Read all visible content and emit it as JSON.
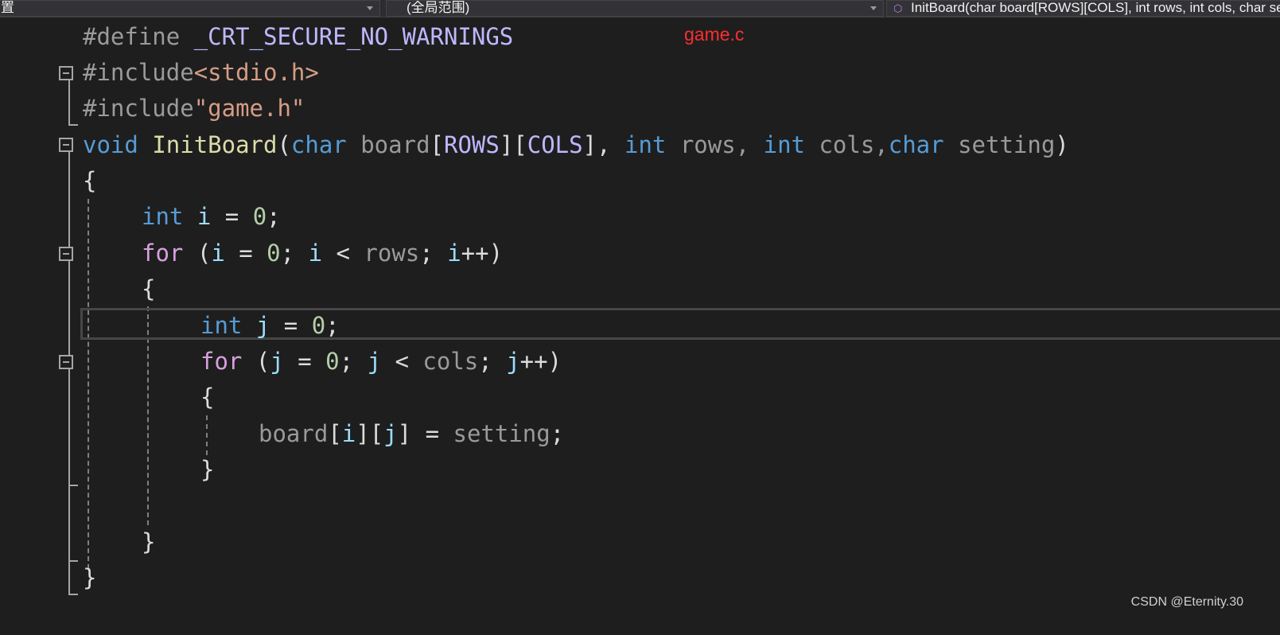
{
  "navbar": {
    "project_combo": "置",
    "scope_combo": "(全局范围)",
    "member_combo": "InitBoard(char board[ROWS][COLS], int rows, int cols, char setting)"
  },
  "annotation": "game.c",
  "watermark": "CSDN @Eternity.30",
  "code": {
    "l1": {
      "directive": "#define ",
      "macro": "_CRT_SECURE_NO_WARNINGS"
    },
    "l2": {
      "directive": "#include",
      "header": "<stdio.h>"
    },
    "l3": {
      "directive": "#include",
      "header": "\"game.h\""
    },
    "l4": {
      "ret": "void",
      "name": "InitBoard",
      "p_open": "(",
      "t1": "char",
      "p1": " board",
      "b1": "[",
      "m1": "ROWS",
      "b2": "][",
      "m2": "COLS",
      "b3": "], ",
      "t2": "int",
      "p2": " rows, ",
      "t3": "int",
      "p3": " cols,",
      "t4": "char",
      "p4": " setting",
      "p_close": ")"
    },
    "l5": {
      "brace": "{"
    },
    "l6": {
      "type": "int",
      "var": " i",
      "op": " = ",
      "num": "0",
      "end": ";"
    },
    "l7": {
      "kw": "for",
      "open": " (",
      "i1": "i",
      "a1": " = ",
      "n1": "0",
      "s1": "; ",
      "i2": "i",
      "lt": " < ",
      "rows": "rows",
      "s2": "; ",
      "i3": "i",
      "inc": "++)"
    },
    "l8": {
      "brace": "{"
    },
    "l9": {
      "type": "int",
      "var": " j",
      "op": " = ",
      "num": "0",
      "end": ";"
    },
    "l10": {
      "kw": "for",
      "open": " (",
      "j1": "j",
      "a1": " = ",
      "n1": "0",
      "s1": "; ",
      "j2": "j",
      "lt": " < ",
      "cols": "cols",
      "s2": "; ",
      "j3": "j",
      "inc": "++)"
    },
    "l11": {
      "brace": "{"
    },
    "l12": {
      "board": "board",
      "b1": "[",
      "i": "i",
      "b2": "][",
      "j": "j",
      "b3": "]",
      "assign": " = ",
      "setting": "setting",
      "end": ";"
    },
    "l13": {
      "brace": "}"
    },
    "l14": {
      "brace": "}"
    },
    "l15": {
      "brace": "}"
    }
  }
}
